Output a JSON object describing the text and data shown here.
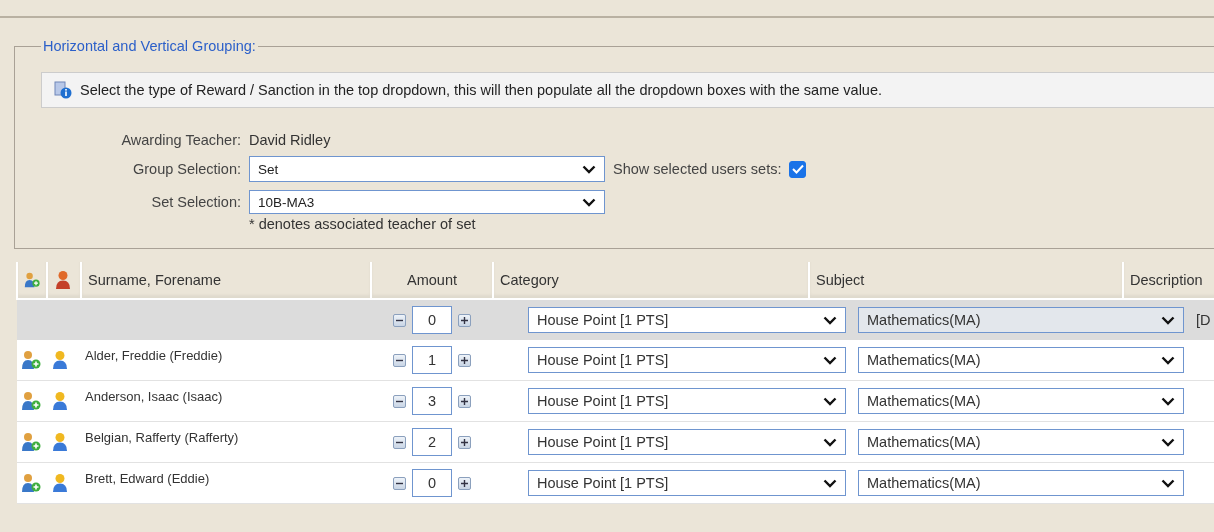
{
  "fieldset": {
    "legend": "Horizontal and Vertical Grouping:"
  },
  "info": {
    "text": "Select the type of Reward / Sanction in the top dropdown, this will then populate all the dropdown boxes with the same value."
  },
  "form": {
    "awarding_label": "Awarding Teacher:",
    "awarding_value": "David Ridley",
    "group_label": "Group Selection:",
    "group_value": "Set",
    "show_sets_label": "Show selected users sets:",
    "show_sets_checked": true,
    "set_label": "Set Selection:",
    "set_value": "10B-MA3",
    "set_note": "* denotes associated teacher of set"
  },
  "table": {
    "columns": [
      "Surname, Forename",
      "Amount",
      "Category",
      "Subject",
      "Description"
    ],
    "master_row": {
      "amount": "0",
      "category": "House Point [1 PTS]",
      "subject": "Mathematics(MA)",
      "description": "[D"
    },
    "rows": [
      {
        "name": "Alder, Freddie (Freddie)",
        "amount": "1",
        "category": "House Point [1 PTS]",
        "subject": "Mathematics(MA)"
      },
      {
        "name": "Anderson, Isaac (Isaac)",
        "amount": "3",
        "category": "House Point [1 PTS]",
        "subject": "Mathematics(MA)"
      },
      {
        "name": "Belgian, Rafferty (Rafferty)",
        "amount": "2",
        "category": "House Point [1 PTS]",
        "subject": "Mathematics(MA)"
      },
      {
        "name": "Brett, Edward (Eddie)",
        "amount": "0",
        "category": "House Point [1 PTS]",
        "subject": "Mathematics(MA)"
      }
    ]
  }
}
